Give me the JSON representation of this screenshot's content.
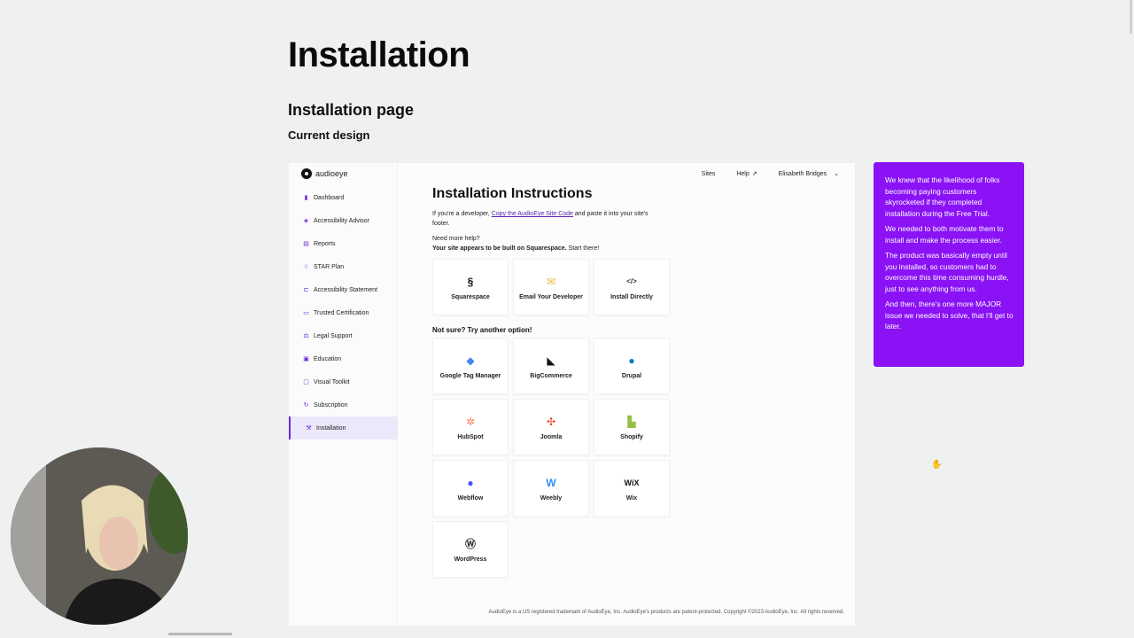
{
  "slide": {
    "title": "Installation",
    "section": "Installation page",
    "subsection": "Current design"
  },
  "app": {
    "logo_text": "audioeye",
    "topbar": {
      "sites": "Sites",
      "help": "Help",
      "user": "Elisabeth Bridges"
    },
    "nav": [
      {
        "label": "Dashboard",
        "icon": "bar-chart-icon"
      },
      {
        "label": "Accessibility Advisor",
        "icon": "shield-icon"
      },
      {
        "label": "Reports",
        "icon": "document-icon"
      },
      {
        "label": "STAR Plan",
        "icon": "star-icon"
      },
      {
        "label": "Accessibility Statement",
        "icon": "statement-icon"
      },
      {
        "label": "Trusted Certification",
        "icon": "certificate-icon"
      },
      {
        "label": "Legal Support",
        "icon": "scales-icon"
      },
      {
        "label": "Education",
        "icon": "book-icon"
      },
      {
        "label": "Visual Toolkit",
        "icon": "toolkit-icon"
      },
      {
        "label": "Subscription",
        "icon": "refresh-icon"
      },
      {
        "label": "Installation",
        "icon": "wrench-icon",
        "active": true
      }
    ],
    "main": {
      "heading": "Installation Instructions",
      "intro_prefix": "If you're a developer, ",
      "intro_link": "Copy the AudioEye Site Code",
      "intro_suffix": " and paste it into your site's footer.",
      "need_help": "Need more help?",
      "built_on": "Your site appears to be built on Squarespace.",
      "start_there": " Start there!",
      "primary_options": [
        {
          "label": "Squarespace",
          "icon": "squarespace-icon"
        },
        {
          "label": "Email Your Developer",
          "icon": "envelope-icon"
        },
        {
          "label": "Install Directly",
          "icon": "code-icon"
        }
      ],
      "alt_title": "Not sure? Try another option!",
      "alt_options": [
        {
          "label": "Google Tag Manager",
          "icon": "google-tag-manager-icon"
        },
        {
          "label": "BigCommerce",
          "icon": "bigcommerce-icon"
        },
        {
          "label": "Drupal",
          "icon": "drupal-icon"
        },
        {
          "label": "HubSpot",
          "icon": "hubspot-icon"
        },
        {
          "label": "Joomla",
          "icon": "joomla-icon"
        },
        {
          "label": "Shopify",
          "icon": "shopify-icon"
        },
        {
          "label": "Webflow",
          "icon": "webflow-icon"
        },
        {
          "label": "Weebly",
          "icon": "weebly-icon"
        },
        {
          "label": "Wix",
          "icon": "wix-icon"
        },
        {
          "label": "WordPress",
          "icon": "wordpress-icon"
        }
      ]
    },
    "footer": "AudioEye is a US registered trademark of AudioEye, Inc. AudioEye's products are patent-protected. Copyright ©2023 AudioEye, Inc. All rights reserved."
  },
  "note": {
    "paragraphs": [
      "We knew that the likelihood of folks becoming paying customers skyrocketed if they completed installation during the Free Trial.",
      "We needed to both motivate them to install and make the process easier.",
      "The product was basically empty until you installed, so customers had to overcome this time consuming hurdle, just to see anything from us.",
      "And then, there's one more MAJOR issue we needed to solve, that I'll get to later."
    ],
    "color": "#8a12f4"
  },
  "colors": {
    "accent": "#6d28d9",
    "background": "#eef1ef"
  }
}
